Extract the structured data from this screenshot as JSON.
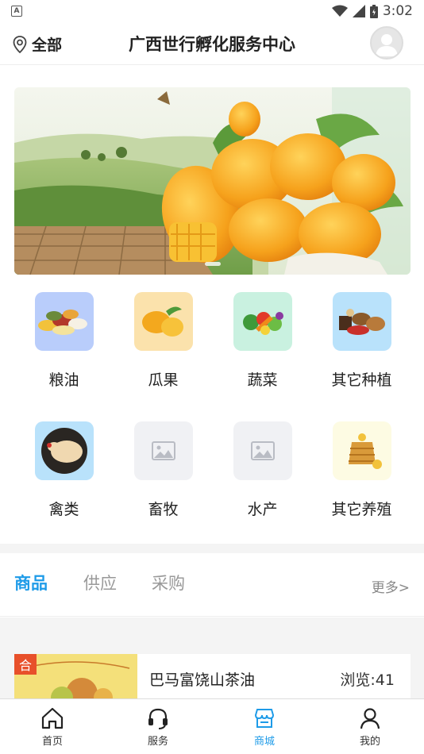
{
  "status_bar": {
    "notification_icon": "A",
    "time": "3:02"
  },
  "header": {
    "location_label": "全部",
    "title": "广西世行孵化服务中心"
  },
  "categories": [
    {
      "label": "粮油",
      "icon": "grains-icon",
      "bg": "#b9cdfb"
    },
    {
      "label": "瓜果",
      "icon": "mango-icon",
      "bg": "#fbe2ac"
    },
    {
      "label": "蔬菜",
      "icon": "vegetables-icon",
      "bg": "#c9f1e0"
    },
    {
      "label": "其它种植",
      "icon": "nuts-icon",
      "bg": "#b9e2fb"
    },
    {
      "label": "禽类",
      "icon": "chicken-icon",
      "bg": "#b9e2fb"
    },
    {
      "label": "畜牧",
      "icon": "image-placeholder-icon",
      "bg": "#f0f1f4"
    },
    {
      "label": "水产",
      "icon": "image-placeholder-icon",
      "bg": "#f0f1f4"
    },
    {
      "label": "其它养殖",
      "icon": "honey-icon",
      "bg": "#fdfbe3"
    }
  ],
  "tabs": [
    {
      "label": "商品",
      "active": true
    },
    {
      "label": "供应",
      "active": false
    },
    {
      "label": "采购",
      "active": false
    }
  ],
  "more_label": "更多>",
  "products": [
    {
      "badge": "合",
      "name": "巴马富饶山茶油",
      "views": "浏览:41"
    }
  ],
  "bottom_nav": [
    {
      "label": "首页",
      "icon": "home-icon",
      "active": false
    },
    {
      "label": "服务",
      "icon": "headset-icon",
      "active": false
    },
    {
      "label": "商城",
      "icon": "shop-icon",
      "active": true
    },
    {
      "label": "我的",
      "icon": "user-icon",
      "active": false
    }
  ],
  "colors": {
    "accent": "#1e9be8",
    "badge": "#e8502a"
  }
}
